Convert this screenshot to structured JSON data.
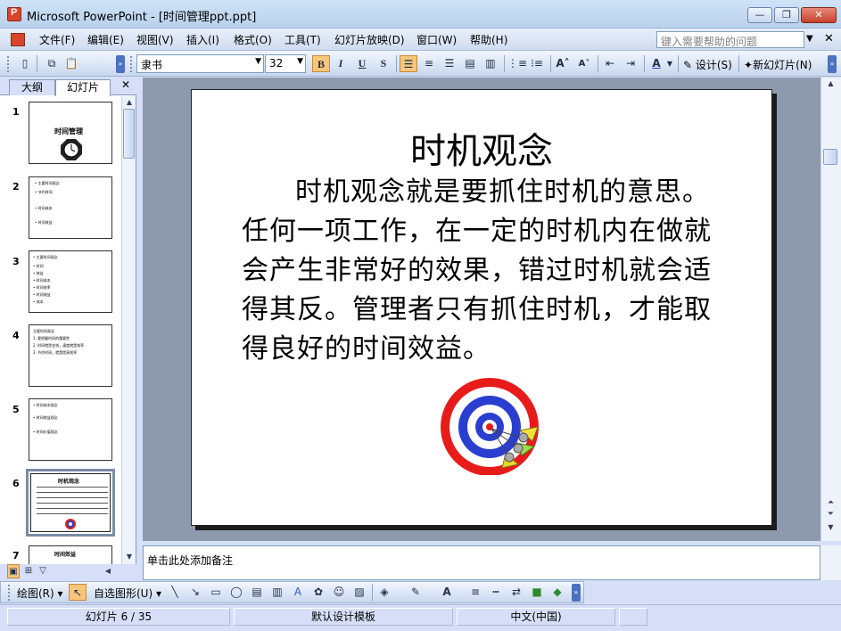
{
  "window": {
    "title": "Microsoft PowerPoint - [时间管理ppt.ppt]",
    "min_glyph": "—",
    "max_glyph": "❐",
    "close_glyph": "✕"
  },
  "menu": {
    "items": [
      "文件(F)",
      "编辑(E)",
      "视图(V)",
      "插入(I)",
      "格式(O)",
      "工具(T)",
      "幻灯片放映(D)",
      "窗口(W)",
      "帮助(H)"
    ],
    "help_placeholder": "键入需要帮助的问题",
    "close_glyph": "✕"
  },
  "toolbar": {
    "font_name": "隶书",
    "font_size": "32",
    "bold": "B",
    "italic": "I",
    "underline": "U",
    "shadow": "S",
    "design_label": "设计(S)",
    "new_slide_label": "新幻灯片(N)"
  },
  "left_pane": {
    "tabs": [
      "大纲",
      "幻灯片"
    ],
    "close_glyph": "✕",
    "thumbnails": [
      {
        "num": "1",
        "lines": [
          "时间管理"
        ]
      },
      {
        "num": "2",
        "lines": [
          "• 主要时间观念",
          "• 节约时间",
          "• 时间成本",
          "• 时间效益"
        ]
      },
      {
        "num": "3",
        "lines": [
          "• 主要时间观念",
          "• 时间",
          "• 效益",
          "• 时间成本",
          "• 时间效率",
          "• 时间效益",
          "• 成本"
        ]
      },
      {
        "num": "4",
        "lines": [
          "主要时间观念",
          "1. 要把握时间的重要性",
          "2. 时间就是金钱，速度就是效率",
          "3. 节约时间，就是提高效率"
        ]
      },
      {
        "num": "5",
        "lines": [
          "• 时间成本观念",
          "• 时间效益观念",
          "• 时间价值观念"
        ]
      },
      {
        "num": "6",
        "lines": [
          "时机观念"
        ]
      },
      {
        "num": "7",
        "lines": [
          "时间效益"
        ]
      }
    ]
  },
  "slide": {
    "title": "时机观念",
    "body": "时机观念就是要抓住时机的意思。任何一项工作，在一定的时机内在做就会产生非常好的效果，错过时机就会适得其反。管理者只有抓住时机，才能取得良好的时间效益。"
  },
  "notes": {
    "placeholder": "单击此处添加备注"
  },
  "drawing_toolbar": {
    "draw_label": "绘图(R)",
    "autoshape_label": "自选图形(U)"
  },
  "status": {
    "slide_info": "幻灯片 6 / 35",
    "template": "默认设计模板",
    "language": "中文(中国)"
  },
  "colors": {
    "accent_active": "#f6c77b",
    "target_red": "#e81b1b",
    "target_blue": "#2a3fd0"
  }
}
